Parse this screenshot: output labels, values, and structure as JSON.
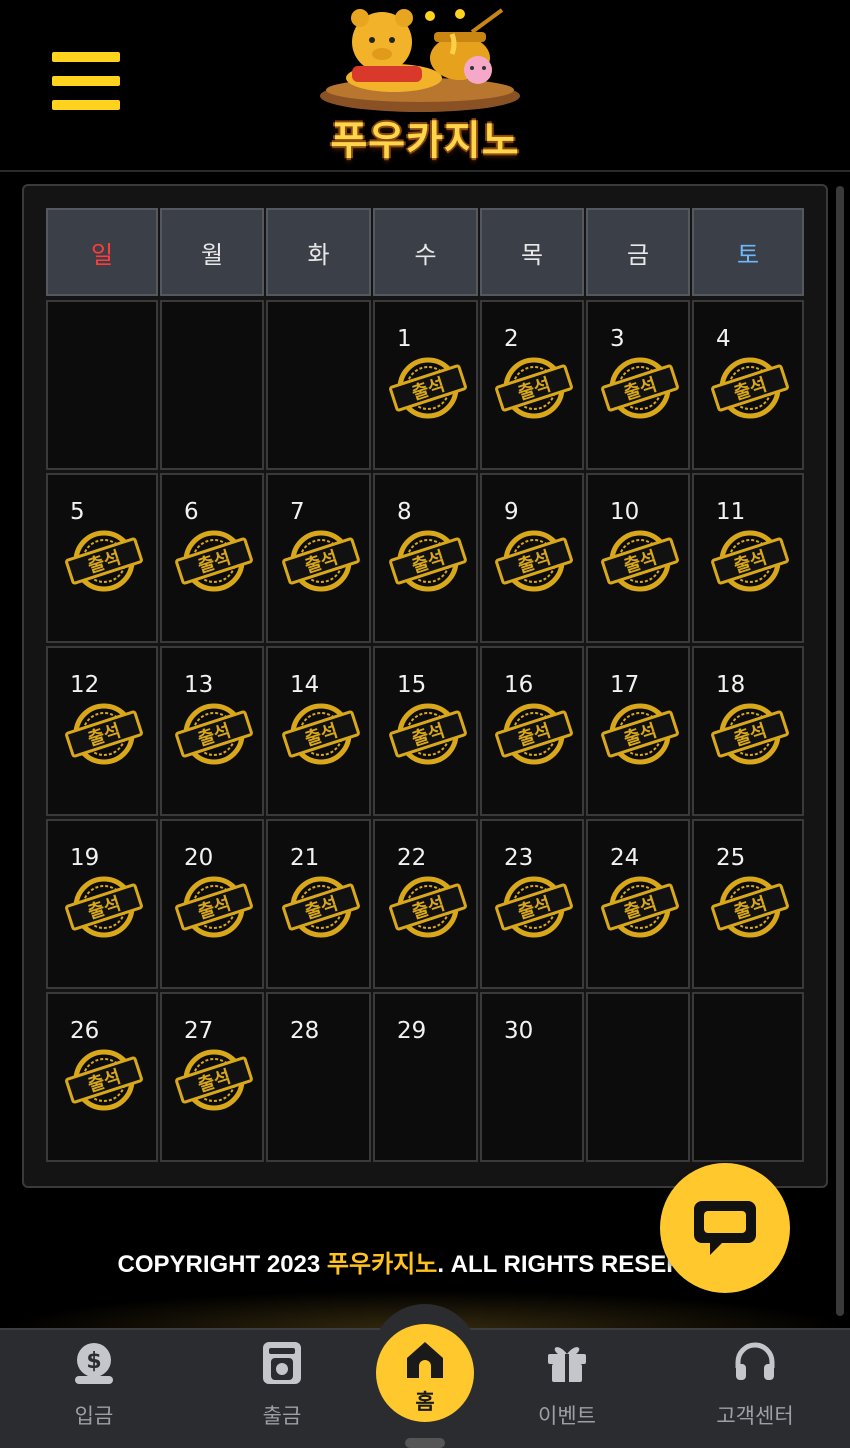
{
  "header": {
    "logo_text": "푸우카지노"
  },
  "calendar": {
    "weekdays": [
      {
        "label": "일",
        "color": "#ff3b3b"
      },
      {
        "label": "월",
        "color": "#e8e8e8"
      },
      {
        "label": "화",
        "color": "#e8e8e8"
      },
      {
        "label": "수",
        "color": "#e8e8e8"
      },
      {
        "label": "목",
        "color": "#e8e8e8"
      },
      {
        "label": "금",
        "color": "#e8e8e8"
      },
      {
        "label": "토",
        "color": "#6fb7ff"
      }
    ],
    "first_weekday_index": 3,
    "days_in_month": 30,
    "attended_days": [
      1,
      2,
      3,
      4,
      5,
      6,
      7,
      8,
      9,
      10,
      11,
      12,
      13,
      14,
      15,
      16,
      17,
      18,
      19,
      20,
      21,
      22,
      23,
      24,
      25,
      26,
      27
    ],
    "stamp_text": "출석",
    "stamp_color": "#d9a81a"
  },
  "footer": {
    "copyright_prefix": "COPYRIGHT 2023 ",
    "copyright_brand": "푸우카지노",
    "copyright_suffix": ". ALL RIGHTS RESERVED",
    "brand_color": "#ffc21e"
  },
  "chat": {
    "icon": "chat-bubble-icon"
  },
  "bottom_nav": {
    "deposit_label": "입금",
    "withdraw_label": "출금",
    "home_label": "홈",
    "event_label": "이벤트",
    "support_label": "고객센터"
  },
  "colors": {
    "accent": "#ffc82c",
    "nav_bg": "#2b2c30"
  }
}
